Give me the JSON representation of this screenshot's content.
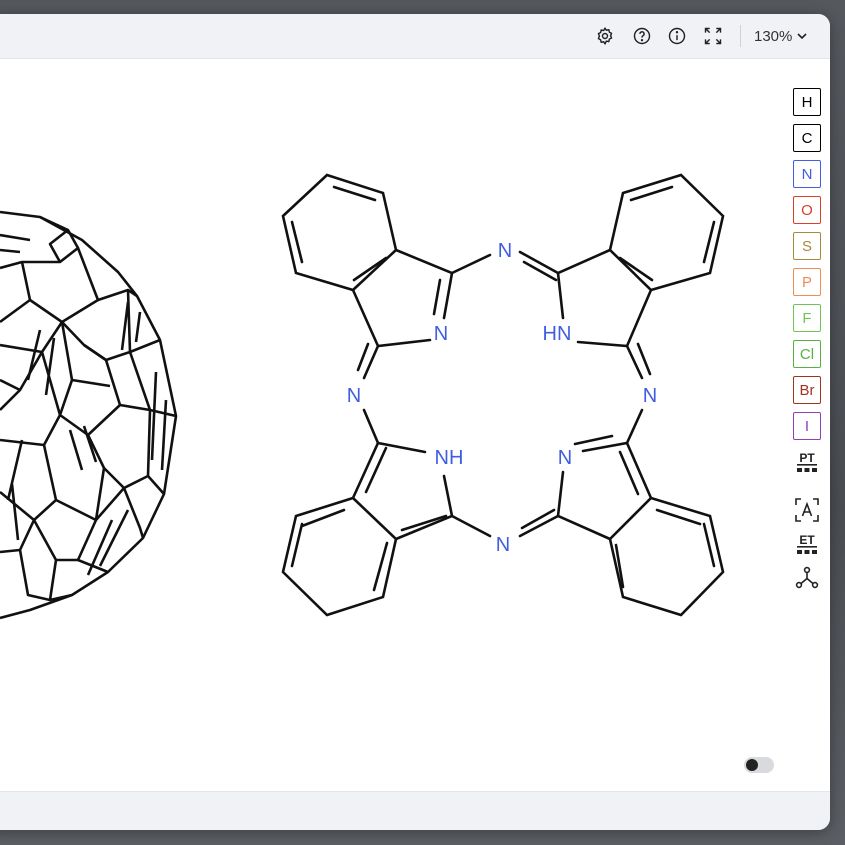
{
  "toolbar": {
    "zoom_label": "130%",
    "icons": [
      "gear-icon",
      "help-icon",
      "info-icon",
      "fullscreen-icon",
      "chevron-down-icon"
    ]
  },
  "atoms_toolbar": {
    "atoms": [
      {
        "symbol": "H",
        "color": "#000000"
      },
      {
        "symbol": "C",
        "color": "#000000"
      },
      {
        "symbol": "N",
        "color": "#3f5fe0"
      },
      {
        "symbol": "O",
        "color": "#d9412a"
      },
      {
        "symbol": "S",
        "color": "#a88a3f"
      },
      {
        "symbol": "P",
        "color": "#f08b54"
      },
      {
        "symbol": "F",
        "color": "#72c45a"
      },
      {
        "symbol": "Cl",
        "color": "#56b23c"
      },
      {
        "symbol": "Br",
        "color": "#a0341f"
      },
      {
        "symbol": "I",
        "color": "#8f3fb0"
      }
    ],
    "periodic_table_label": "PT",
    "extended_table_label": "ET",
    "icons": [
      "atom-label-icon",
      "rgroup-icon"
    ]
  },
  "molecule": {
    "nitrogen_color": "#3f5fe0",
    "atom_labels": {
      "n_top": "N",
      "n_left": "N",
      "n_right": "N",
      "n_bottom": "N",
      "n_inner_tl": "N",
      "n_inner_tr": "HN",
      "n_inner_bl": "NH",
      "n_inner_br": "N"
    }
  },
  "toggle": {
    "state": "off"
  }
}
